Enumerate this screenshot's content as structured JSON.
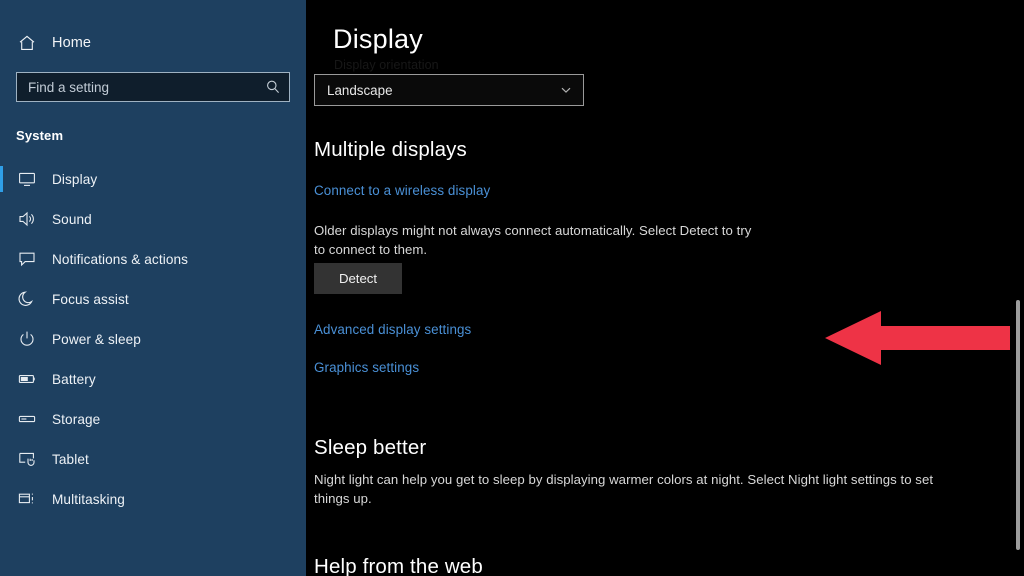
{
  "sidebar": {
    "home": {
      "label": "Home",
      "icon": "home-icon"
    },
    "search": {
      "placeholder": "Find a setting",
      "value": "",
      "icon": "search-icon"
    },
    "section_title": "System",
    "items": [
      {
        "label": "Display",
        "icon": "monitor-icon",
        "selected": true
      },
      {
        "label": "Sound",
        "icon": "speaker-icon",
        "selected": false
      },
      {
        "label": "Notifications & actions",
        "icon": "chat-bubble-icon",
        "selected": false
      },
      {
        "label": "Focus assist",
        "icon": "moon-icon",
        "selected": false
      },
      {
        "label": "Power & sleep",
        "icon": "power-icon",
        "selected": false
      },
      {
        "label": "Battery",
        "icon": "battery-icon",
        "selected": false
      },
      {
        "label": "Storage",
        "icon": "drive-icon",
        "selected": false
      },
      {
        "label": "Tablet",
        "icon": "tablet-touch-icon",
        "selected": false
      },
      {
        "label": "Multitasking",
        "icon": "multitasking-icon",
        "selected": false
      }
    ]
  },
  "main": {
    "page_title": "Display",
    "orientation": {
      "label": "Display orientation",
      "value": "Landscape",
      "chevron_icon": "chevron-down-icon"
    },
    "multiple_displays": {
      "heading": "Multiple displays",
      "wireless_link": "Connect to a wireless display",
      "description": "Older displays might not always connect automatically. Select Detect to try to connect to them.",
      "detect_button": "Detect",
      "advanced_link": "Advanced display settings",
      "graphics_link": "Graphics settings"
    },
    "sleep_better": {
      "heading": "Sleep better",
      "description": "Night light can help you get to sleep by displaying warmer colors at night. Select Night light settings to set things up."
    },
    "help": {
      "heading": "Help from the web"
    }
  },
  "annotation": {
    "arrow": {
      "icon": "left-arrow-annotation",
      "direction": "left",
      "color": "#ee3346"
    }
  },
  "scrollbar": {
    "icon": "vertical-scrollbar"
  },
  "colors": {
    "sidebar_bg": "#1e4060",
    "main_bg": "#000000",
    "accent": "#2f9fe8",
    "link": "#4a90d6",
    "arrow_red": "#ee3346",
    "button_bg": "#333333"
  }
}
